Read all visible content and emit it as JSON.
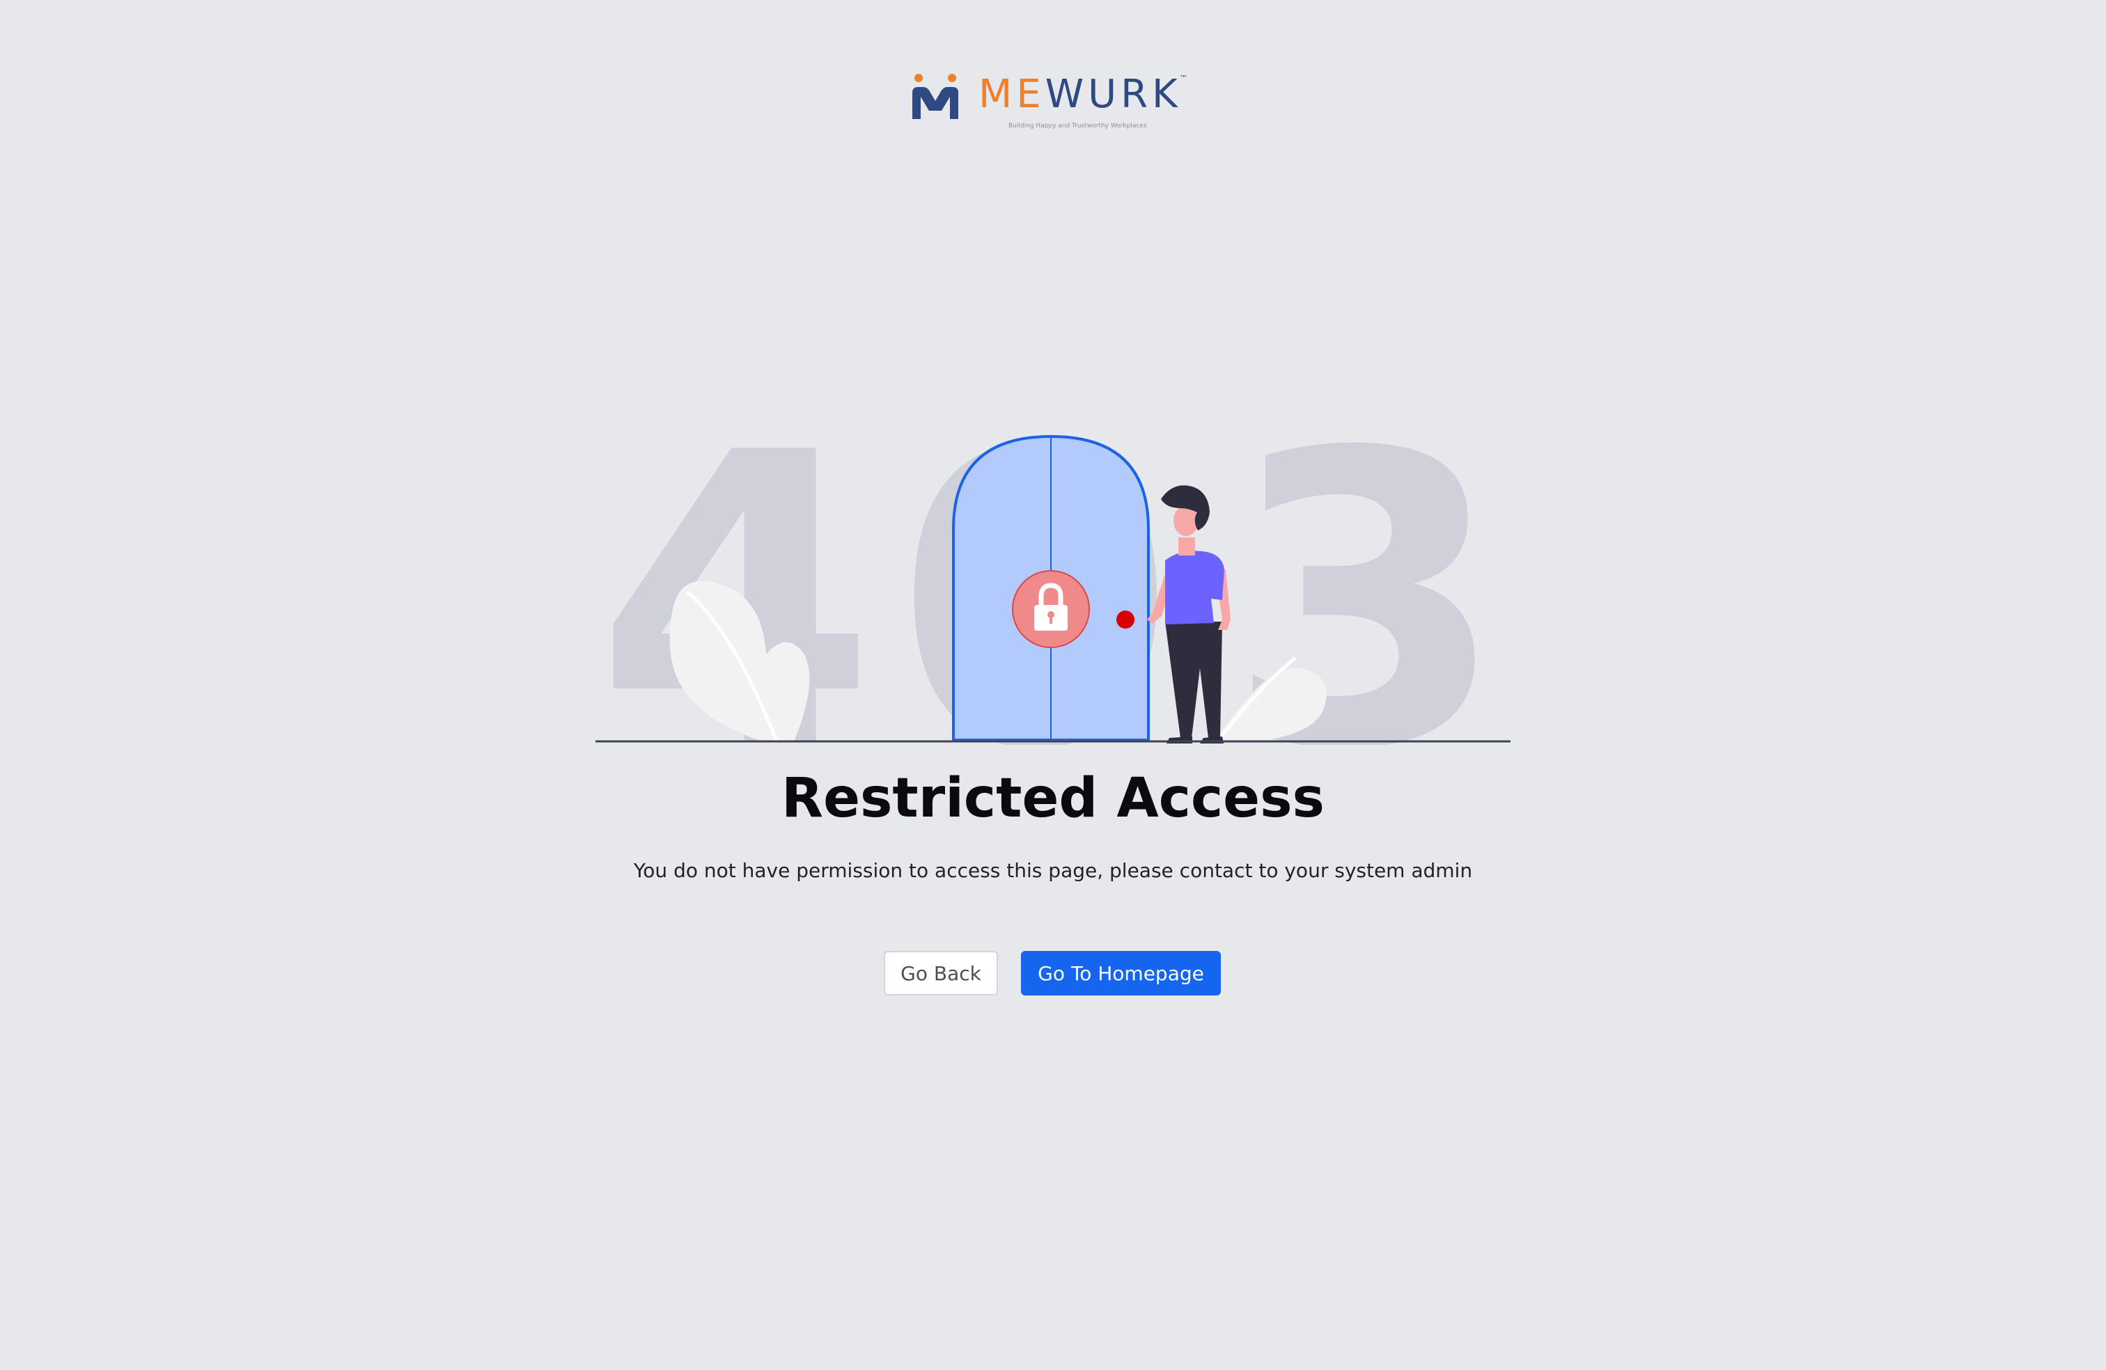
{
  "brand": {
    "name_part1": "ME",
    "name_part2": "WURK",
    "trademark": "™",
    "tagline": "Building Happy and Trustworthy Workplaces",
    "accent_orange": "#f07f2c",
    "accent_navy": "#2f4a82"
  },
  "illustration": {
    "error_code": [
      "4",
      "0",
      "3"
    ],
    "digit_color": "#cfd0da",
    "door_color": "#b3cafc",
    "door_border": "#1e63e6",
    "lock_color": "#f08a8a",
    "person_shirt": "#6c63ff"
  },
  "message": {
    "title": "Restricted Access",
    "description": "You do not have permission to access this page, please contact to your system admin"
  },
  "actions": {
    "back_label": "Go Back",
    "home_label": "Go To Homepage",
    "primary_color": "#1565ee"
  }
}
